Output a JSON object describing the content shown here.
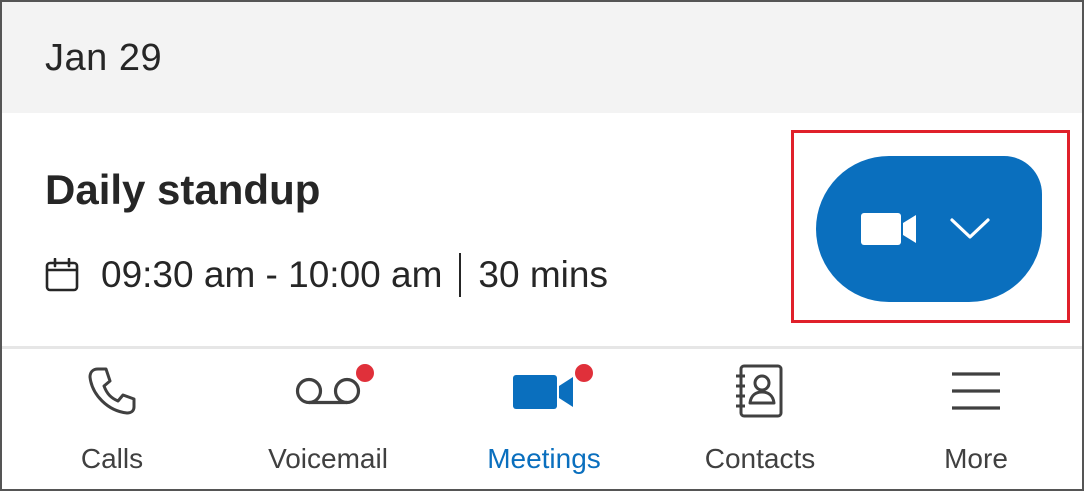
{
  "header": {
    "date": "Jan 29"
  },
  "meeting": {
    "title": "Daily standup",
    "time_range": "09:30 am - 10:00 am",
    "duration": "30 mins",
    "join_button_icon": "video-camera-icon",
    "dropdown_icon": "chevron-down-icon",
    "accent_color": "#0a6fbe"
  },
  "tabs": [
    {
      "label": "Calls",
      "icon": "phone-icon",
      "active": false,
      "badge": false
    },
    {
      "label": "Voicemail",
      "icon": "voicemail-icon",
      "active": false,
      "badge": true
    },
    {
      "label": "Meetings",
      "icon": "video-camera-icon",
      "active": true,
      "badge": true
    },
    {
      "label": "Contacts",
      "icon": "contacts-book-icon",
      "active": false,
      "badge": false
    },
    {
      "label": "More",
      "icon": "hamburger-menu-icon",
      "active": false,
      "badge": false
    }
  ],
  "colors": {
    "badge": "#e0303a",
    "highlight": "#e0202a",
    "active_tab": "#0a6fbe"
  }
}
